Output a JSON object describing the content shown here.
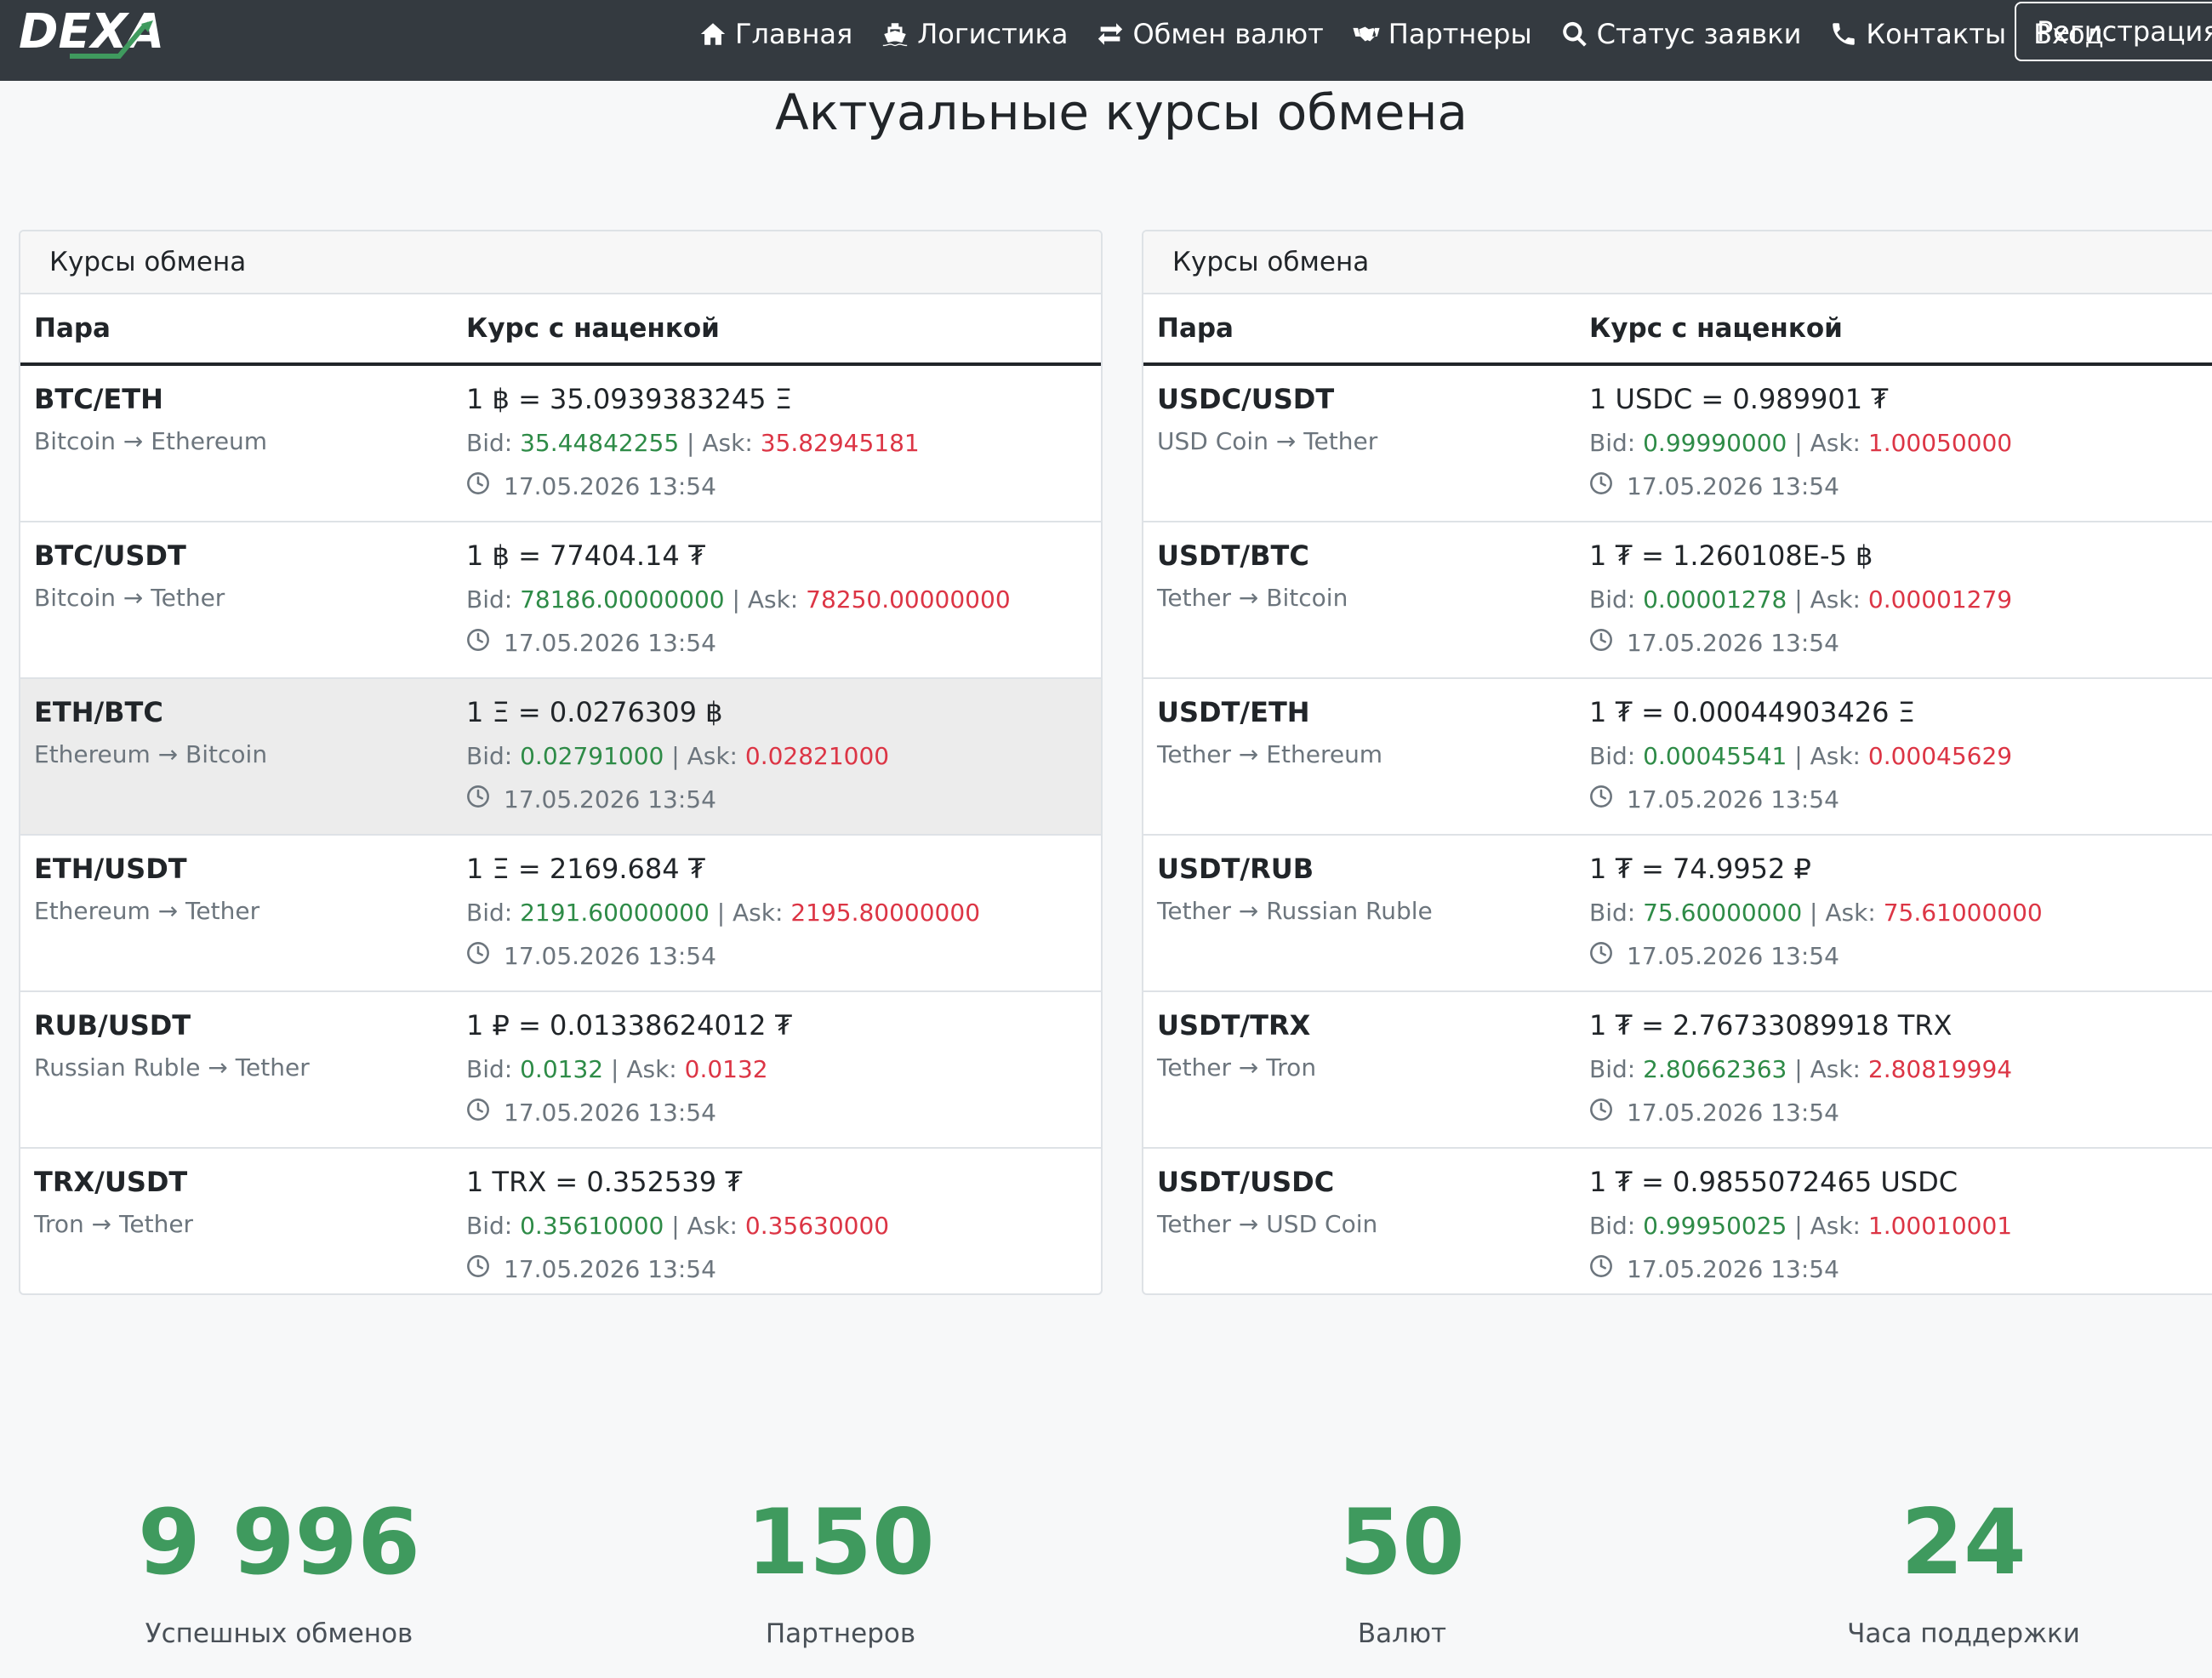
{
  "navbar": {
    "logo_text": "DEXA",
    "items": [
      {
        "label": "Главная",
        "icon": "home-icon"
      },
      {
        "label": "Логистика",
        "icon": "ship-icon"
      },
      {
        "label": "Обмен валют",
        "icon": "exchange-icon"
      },
      {
        "label": "Партнеры",
        "icon": "handshake-icon"
      },
      {
        "label": "Статус заявки",
        "icon": "search-icon"
      },
      {
        "label": "Контакты",
        "icon": "phone-icon"
      },
      {
        "label": "Вход",
        "icon": ""
      }
    ],
    "register_label": "Регистрация"
  },
  "page_title": "Актуальные курсы обмена",
  "tables": [
    {
      "header": "Курсы обмена",
      "col_pair": "Пара",
      "col_rate": "Курс с наценкой",
      "rows": [
        {
          "pair": "BTC/ETH",
          "desc": "Bitcoin → Ethereum",
          "rate": "1 ฿ = 35.0939383245 Ξ",
          "bid_label": "Bid: ",
          "bid": "35.44842255",
          "sep": " | Ask: ",
          "ask": "35.82945181",
          "time": "17.05.2026 13:54"
        },
        {
          "pair": "BTC/USDT",
          "desc": "Bitcoin → Tether",
          "rate": "1 ฿ = 77404.14 ₮",
          "bid_label": "Bid: ",
          "bid": "78186.00000000",
          "sep": " | Ask: ",
          "ask": "78250.00000000",
          "time": "17.05.2026 13:54"
        },
        {
          "pair": "ETH/BTC",
          "desc": "Ethereum → Bitcoin",
          "rate": "1 Ξ = 0.0276309 ฿",
          "bid_label": "Bid: ",
          "bid": "0.02791000",
          "sep": " | Ask: ",
          "ask": "0.02821000",
          "time": "17.05.2026 13:54"
        },
        {
          "pair": "ETH/USDT",
          "desc": "Ethereum → Tether",
          "rate": "1 Ξ = 2169.684 ₮",
          "bid_label": "Bid: ",
          "bid": "2191.60000000",
          "sep": " | Ask: ",
          "ask": "2195.80000000",
          "time": "17.05.2026 13:54"
        },
        {
          "pair": "RUB/USDT",
          "desc": "Russian Ruble → Tether",
          "rate": "1 ₽ = 0.01338624012 ₮",
          "bid_label": "Bid: ",
          "bid": "0.0132",
          "sep": " | Ask: ",
          "ask": "0.0132",
          "time": "17.05.2026 13:54"
        },
        {
          "pair": "TRX/USDT",
          "desc": "Tron → Tether",
          "rate": "1 TRX = 0.352539 ₮",
          "bid_label": "Bid: ",
          "bid": "0.35610000",
          "sep": " | Ask: ",
          "ask": "0.35630000",
          "time": "17.05.2026 13:54"
        }
      ]
    },
    {
      "header": "Курсы обмена",
      "col_pair": "Пара",
      "col_rate": "Курс с наценкой",
      "rows": [
        {
          "pair": "USDC/USDT",
          "desc": "USD Coin → Tether",
          "rate": "1 USDC = 0.989901 ₮",
          "bid_label": "Bid: ",
          "bid": "0.99990000",
          "sep": " | Ask: ",
          "ask": "1.00050000",
          "time": "17.05.2026 13:54"
        },
        {
          "pair": "USDT/BTC",
          "desc": "Tether → Bitcoin",
          "rate": "1 ₮ = 1.260108E-5 ฿",
          "bid_label": "Bid: ",
          "bid": "0.00001278",
          "sep": " | Ask: ",
          "ask": "0.00001279",
          "time": "17.05.2026 13:54"
        },
        {
          "pair": "USDT/ETH",
          "desc": "Tether → Ethereum",
          "rate": "1 ₮ = 0.00044903426 Ξ",
          "bid_label": "Bid: ",
          "bid": "0.00045541",
          "sep": " | Ask: ",
          "ask": "0.00045629",
          "time": "17.05.2026 13:54"
        },
        {
          "pair": "USDT/RUB",
          "desc": "Tether → Russian Ruble",
          "rate": "1 ₮ = 74.9952 ₽",
          "bid_label": "Bid: ",
          "bid": "75.60000000",
          "sep": " | Ask: ",
          "ask": "75.61000000",
          "time": "17.05.2026 13:54"
        },
        {
          "pair": "USDT/TRX",
          "desc": "Tether → Tron",
          "rate": "1 ₮ = 2.76733089918 TRX",
          "bid_label": "Bid: ",
          "bid": "2.80662363",
          "sep": " | Ask: ",
          "ask": "2.80819994",
          "time": "17.05.2026 13:54"
        },
        {
          "pair": "USDT/USDC",
          "desc": "Tether → USD Coin",
          "rate": "1 ₮ = 0.9855072465 USDC",
          "bid_label": "Bid: ",
          "bid": "0.99950025",
          "sep": " | Ask: ",
          "ask": "1.00010001",
          "time": "17.05.2026 13:54"
        }
      ]
    }
  ],
  "stats": [
    {
      "value": "9 996",
      "label": "Успешных обменов"
    },
    {
      "value": "150",
      "label": "Партнеров"
    },
    {
      "value": "50",
      "label": "Валют"
    },
    {
      "value": "24",
      "label": "Часа поддержки"
    }
  ],
  "colors": {
    "navbar": "#343a40",
    "bid": "#2e8b47",
    "ask": "#dc3545",
    "stat": "#3f9a5e"
  }
}
